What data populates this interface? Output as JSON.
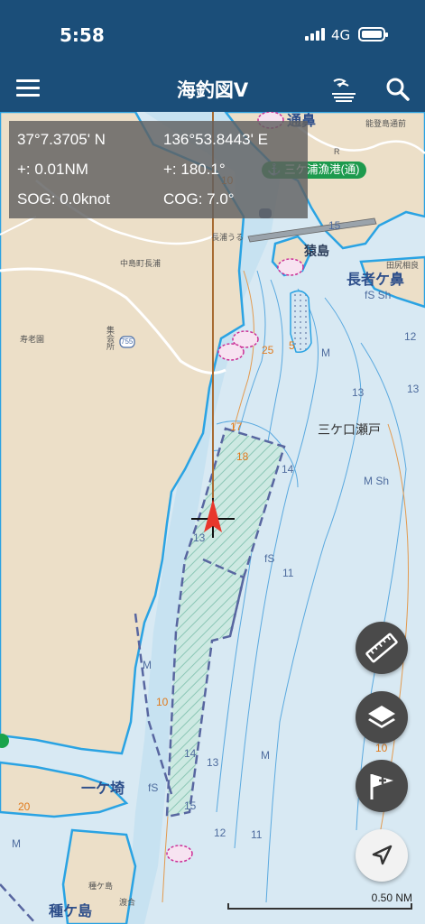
{
  "status_bar": {
    "time": "5:58",
    "network": "4G"
  },
  "nav": {
    "title": "海釣図V"
  },
  "info_panel": {
    "latitude": "37°7.3705' N",
    "longitude": "136°53.8443' E",
    "distance": "+: 0.01NM",
    "bearing": "+: 180.1°",
    "sog": "SOG: 0.0knot",
    "cog": "COG: 7.0°"
  },
  "harbor_tag": "三ケ浦漁港(通)",
  "place_labels": {
    "tsurubana": "通鼻",
    "notorokomae": "能登島通前",
    "saru_jima": "猿島",
    "chojagahana": "長者ケ鼻",
    "tabe": "田尻相良",
    "nagaura": "長浦うる",
    "nakajima_nagaura": "中島町長浦",
    "jurouen": "寿老園",
    "shukaisho": "集会所",
    "mikeguchi_seto": "三ケ口瀬戸",
    "ikkezaki": "一ケ埼",
    "tanega_shima": "種ケ島",
    "tanega_small": "種ケ島",
    "watari": "渡合",
    "route_755": "755",
    "route_rake": "R"
  },
  "depth_labels": [
    {
      "id": "d10a",
      "text": "10"
    },
    {
      "id": "d15a",
      "text": "15"
    },
    {
      "id": "d25",
      "text": "25"
    },
    {
      "id": "d5",
      "text": "5"
    },
    {
      "id": "dM1",
      "text": "M"
    },
    {
      "id": "d12r",
      "text": "12"
    },
    {
      "id": "d13r",
      "text": "13"
    },
    {
      "id": "d17",
      "text": "17"
    },
    {
      "id": "d18",
      "text": "18"
    },
    {
      "id": "d14a",
      "text": "14"
    },
    {
      "id": "dMsh",
      "text": "M Sh"
    },
    {
      "id": "dfSSh",
      "text": "fS Sh"
    },
    {
      "id": "d13c",
      "text": "13"
    },
    {
      "id": "dfS1",
      "text": "fS"
    },
    {
      "id": "d11a",
      "text": "11"
    },
    {
      "id": "dM2",
      "text": "M"
    },
    {
      "id": "d10b",
      "text": "10"
    },
    {
      "id": "d14b",
      "text": "14"
    },
    {
      "id": "d13b",
      "text": "13"
    },
    {
      "id": "dM3",
      "text": "M"
    },
    {
      "id": "dfS2",
      "text": "fS"
    },
    {
      "id": "d15b",
      "text": "15"
    },
    {
      "id": "d10c",
      "text": "10"
    },
    {
      "id": "d20",
      "text": "20"
    },
    {
      "id": "d12b",
      "text": "12"
    },
    {
      "id": "d11b",
      "text": "11"
    },
    {
      "id": "dM4",
      "text": "M"
    },
    {
      "id": "d13d",
      "text": "13"
    }
  ],
  "scale_bar": {
    "label": "0.50 NM"
  },
  "buttons": {
    "ruler": "ruler-icon",
    "layers": "layers-icon",
    "add_mark": "flag-plus-icon",
    "locate": "navigation-arrow-icon"
  },
  "colors": {
    "header": "#1b4e79",
    "land": "#ecdfc8",
    "water_shallow": "#cde7f3",
    "water_deep": "#e3eff7",
    "coast": "#2aa3e3",
    "heading_line": "#e07a1c",
    "boat": "#e8372b",
    "harbor_tag": "#1d9a4d"
  }
}
